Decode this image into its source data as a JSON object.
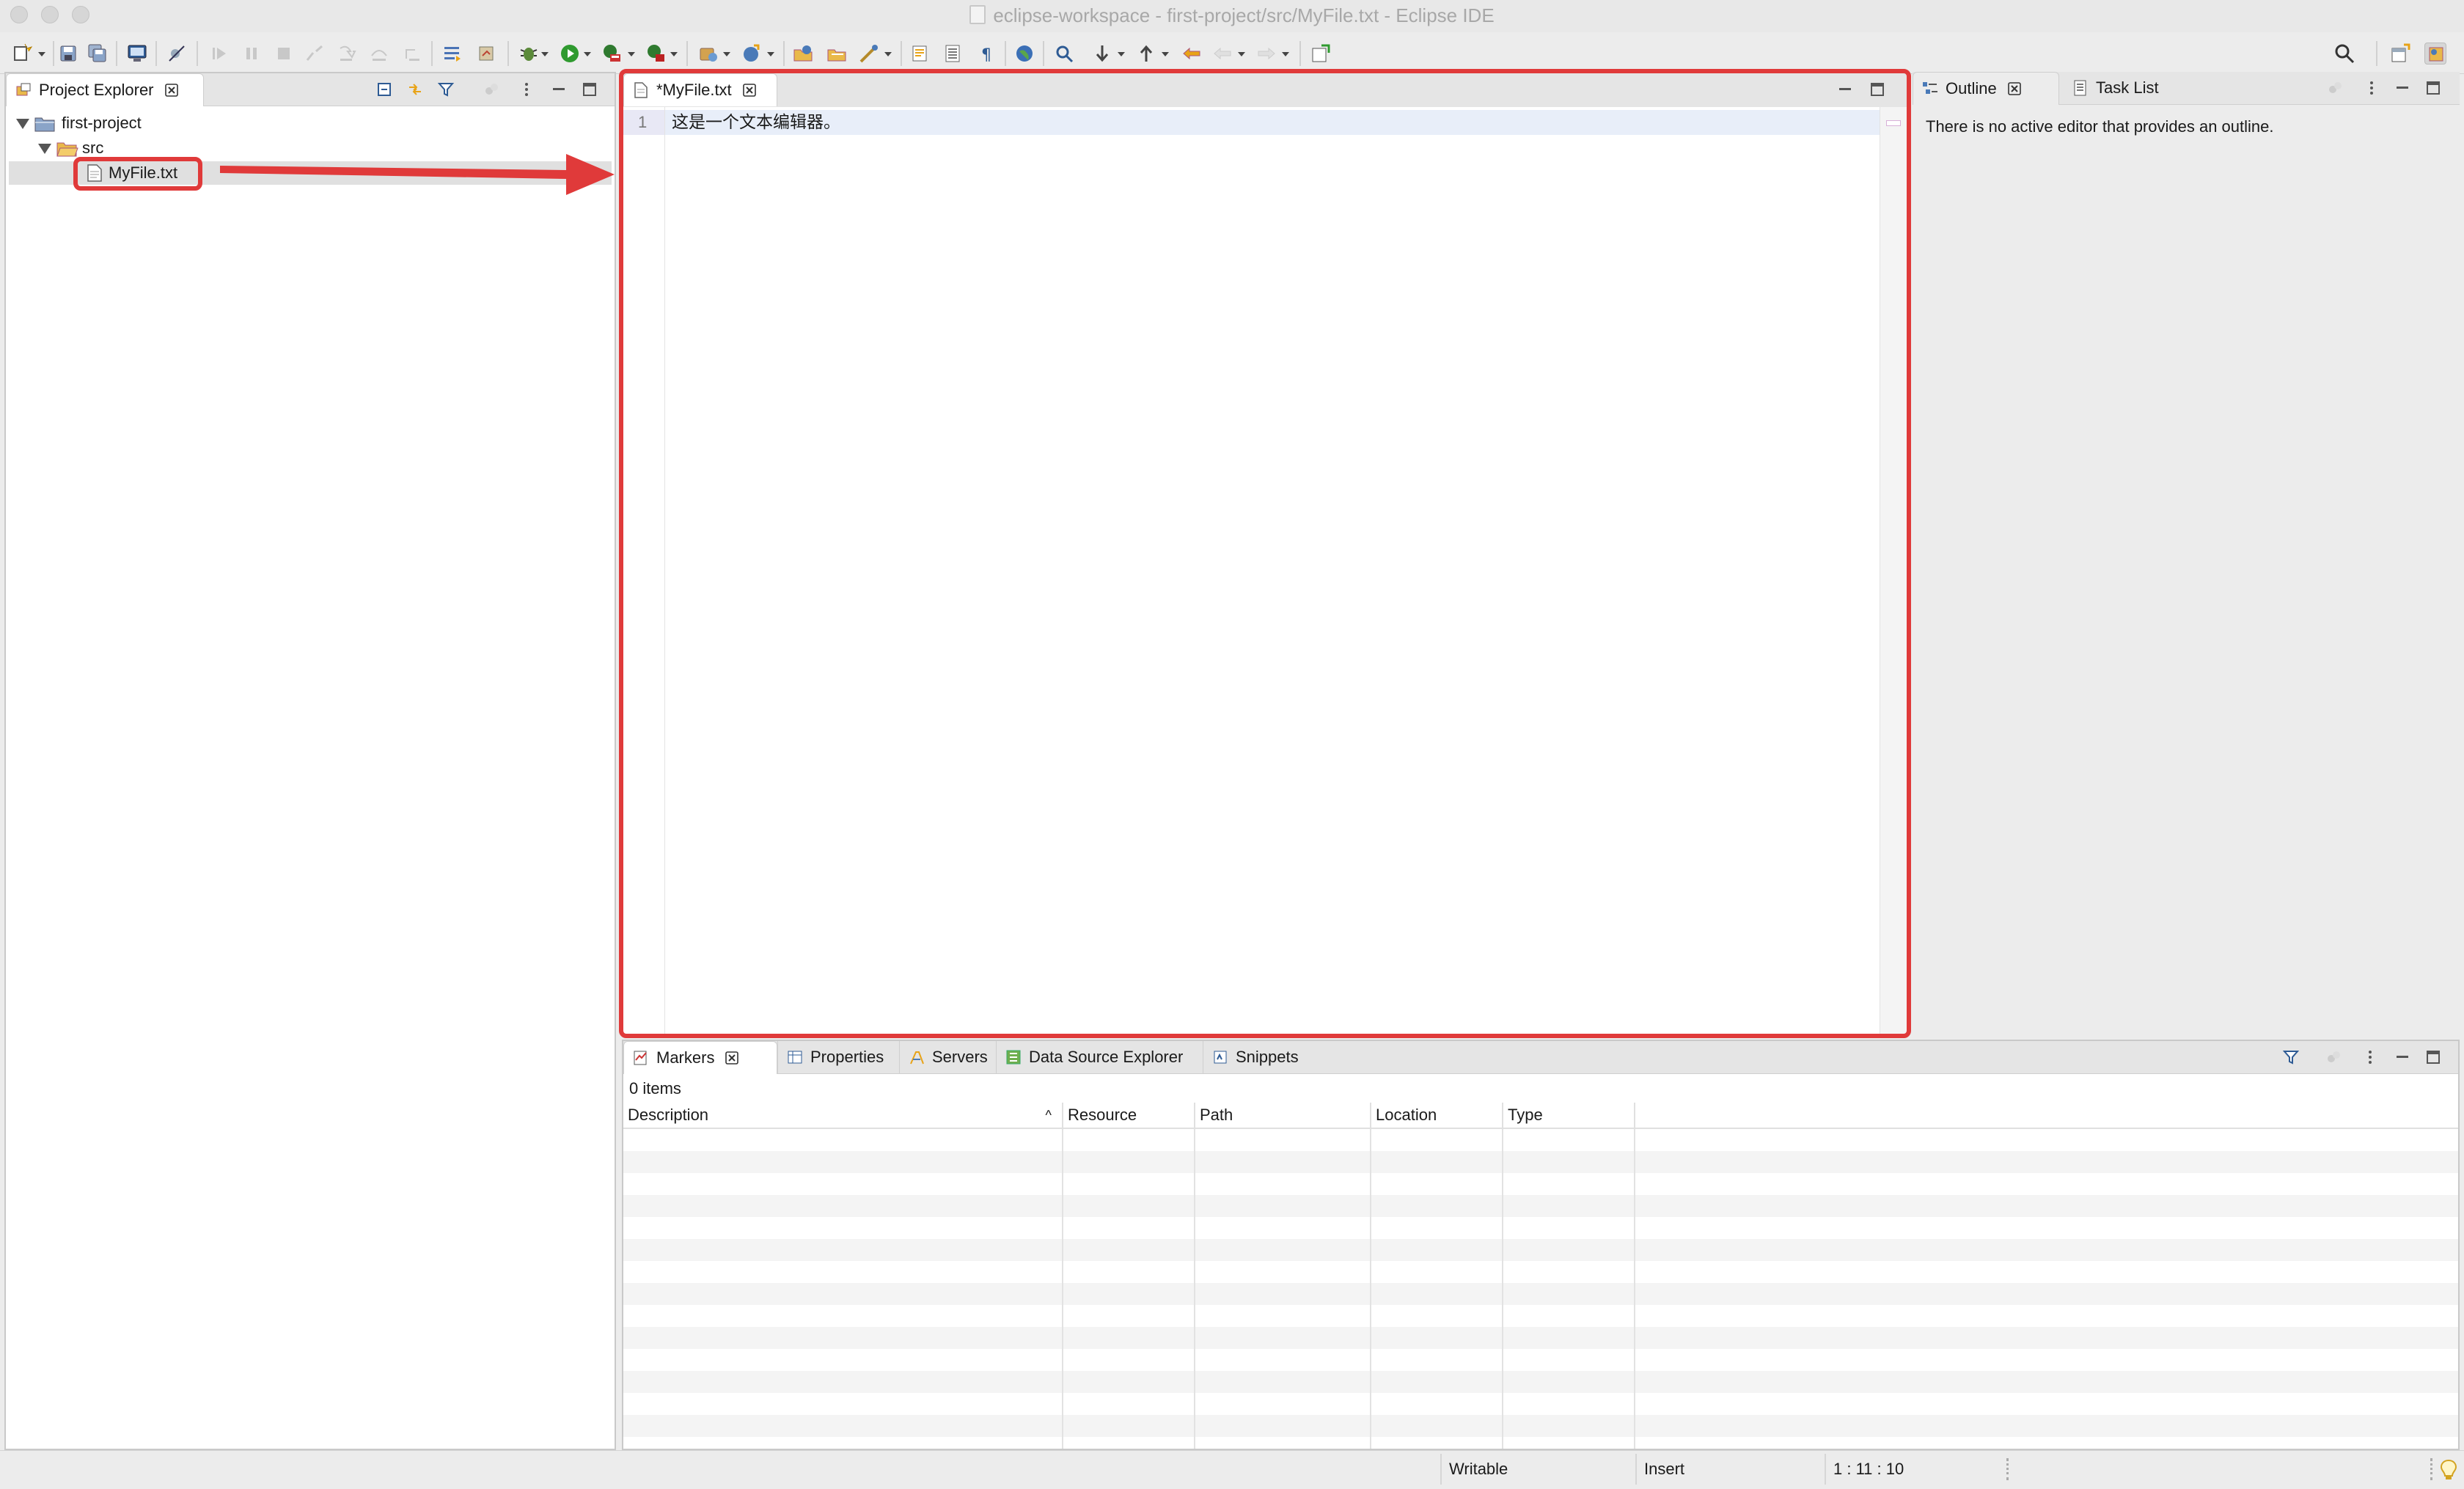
{
  "window": {
    "title": "eclipse-workspace - first-project/src/MyFile.txt - Eclipse IDE"
  },
  "colors": {
    "accent_red": "#e03a3a",
    "tab_bar": "#e5e5e5",
    "selection": "#e0e0e0",
    "current_line": "#e8eef9"
  },
  "toolbar": {
    "icons": [
      "new-icon",
      "save-icon",
      "save-all-icon",
      "terminal-icon",
      "skip-breakpoints-icon",
      "resume-icon",
      "suspend-icon",
      "terminate-icon",
      "disconnect-icon",
      "step-into-icon",
      "step-over-icon",
      "step-return-icon",
      "external-tools-icon",
      "debug-icon",
      "run-icon",
      "coverage-icon",
      "run-external-icon",
      "new-server-icon",
      "new-web-service-icon",
      "open-type-icon",
      "open-task-icon",
      "open-resource-icon",
      "annotation-icon",
      "toggle-block-icon",
      "show-whitespace-icon",
      "globe-icon",
      "search-icon",
      "next-annotation-icon",
      "previous-annotation-icon",
      "last-edit-icon",
      "back-icon",
      "forward-icon",
      "pin-editor-icon",
      "quick-access-icon",
      "open-perspective-icon",
      "javaee-perspective-icon"
    ]
  },
  "project_explorer": {
    "tab_label": "Project Explorer",
    "tree": {
      "project": "first-project",
      "folder": "src",
      "file": "MyFile.txt"
    }
  },
  "editor": {
    "tab_label": "*MyFile.txt",
    "line_number": "1",
    "line_text": "这是一个文本编辑器。"
  },
  "outline": {
    "tab_label": "Outline",
    "tab2_label": "Task List",
    "message": "There is no active editor that provides an outline."
  },
  "bottom": {
    "tabs": [
      "Markers",
      "Properties",
      "Servers",
      "Data Source Explorer",
      "Snippets"
    ],
    "items_count": "0 items",
    "columns": [
      "Description",
      "Resource",
      "Path",
      "Location",
      "Type"
    ]
  },
  "status": {
    "writable": "Writable",
    "insert_mode": "Insert",
    "position": "1 : 11 : 10"
  }
}
